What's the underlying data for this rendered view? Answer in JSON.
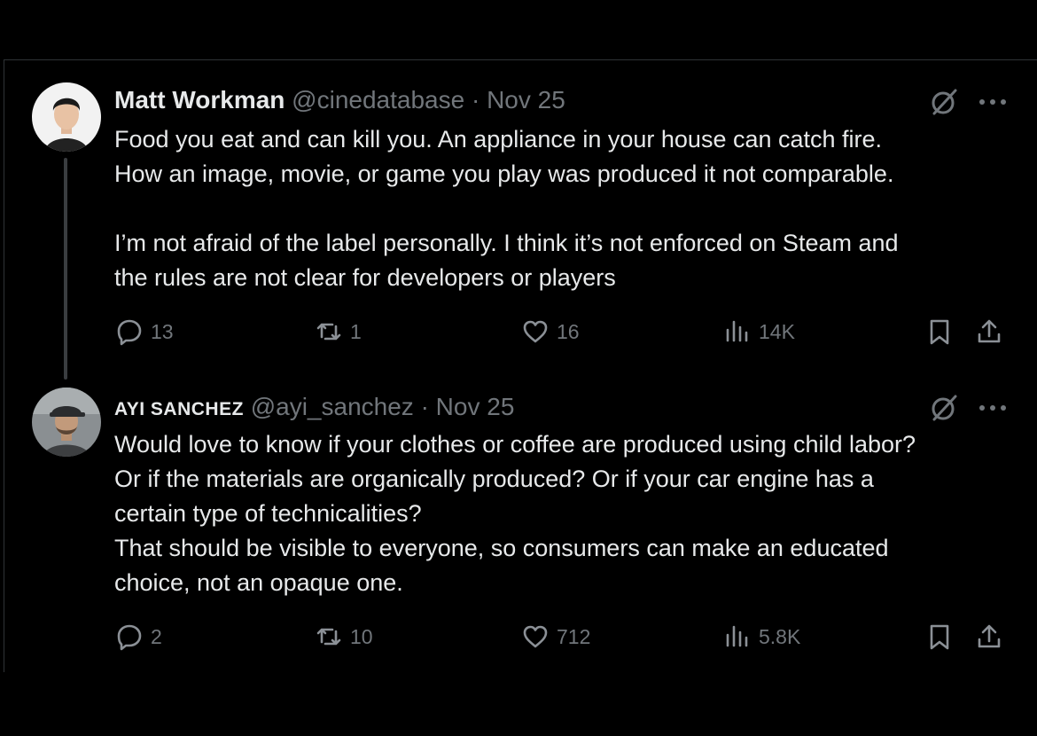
{
  "tweets": [
    {
      "author_name": "Matt Workman",
      "handle": "@cinedatabase",
      "separator": "·",
      "date": "Nov 25",
      "lines": [
        "Food you eat and can kill you.  An appliance in your house can catch fire.",
        "How an image, movie, or game you play was produced it not comparable.",
        "",
        "I’m not afraid of the label personally.  I think it’s not enforced on Steam and",
        "the rules are not clear for developers or players"
      ],
      "replies": "13",
      "reposts": "1",
      "likes": "16",
      "views": "14K"
    },
    {
      "author_name": "AYI SANCHEZ",
      "handle": "@ayi_sanchez",
      "separator": "·",
      "date": "Nov 25",
      "lines": [
        "Would love to know if your clothes or coffee are produced using child labor?",
        "Or if the materials are organically produced? Or if your car engine has a",
        "certain type of technicalities?",
        "That should be visible to everyone, so consumers can make an educated",
        "choice, not an opaque one."
      ],
      "replies": "2",
      "reposts": "10",
      "likes": "712",
      "views": "5.8K"
    }
  ],
  "icons": {
    "reply": "reply-icon",
    "repost": "repost-icon",
    "like": "heart-icon",
    "views": "views-chart-icon",
    "bookmark": "bookmark-icon",
    "share": "share-icon",
    "grok": "grok-icon",
    "more": "more-dots-icon"
  },
  "colors": {
    "background": "#000000",
    "text": "#e7e9ea",
    "muted": "#71767b",
    "divider": "#2f3336"
  }
}
